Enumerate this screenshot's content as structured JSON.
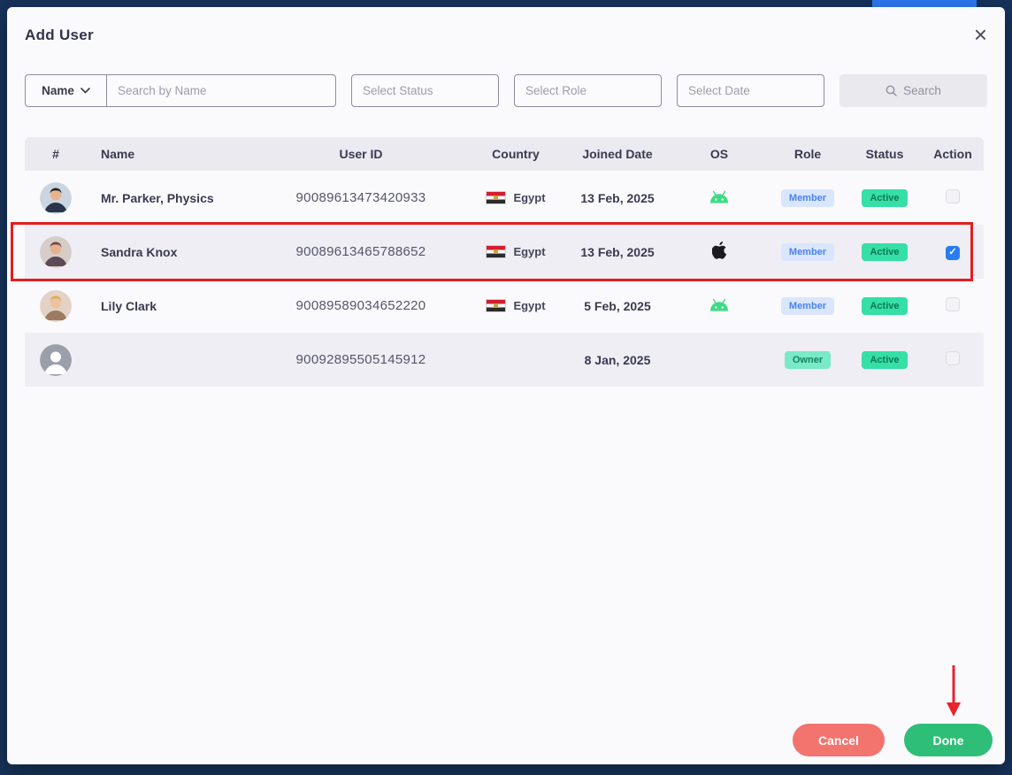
{
  "modal": {
    "title": "Add User"
  },
  "icons": {
    "close": "×",
    "check": "✓"
  },
  "filters": {
    "name_dropdown_label": "Name",
    "search_placeholder": "Search by Name",
    "status_placeholder": "Select Status",
    "role_placeholder": "Select Role",
    "date_placeholder": "Select Date",
    "search_button_label": "Search"
  },
  "table": {
    "headers": [
      "#",
      "Name",
      "User ID",
      "Country",
      "Joined Date",
      "OS",
      "Role",
      "Status",
      "Action"
    ],
    "rows": [
      {
        "name": "Mr. Parker, Physics",
        "user_id": "90089613473420933",
        "country": "Egypt",
        "joined": "13 Feb, 2025",
        "os": "android",
        "role": "Member",
        "status": "Active",
        "checked": false,
        "striped": false,
        "highlighted": false,
        "avatar": {
          "bg": "#c9d6e2",
          "skin": "#e9b48c",
          "body": "#28354d",
          "hair": "#262220"
        }
      },
      {
        "name": "Sandra Knox",
        "user_id": "90089613465788652",
        "country": "Egypt",
        "joined": "13 Feb, 2025",
        "os": "apple",
        "role": "Member",
        "status": "Active",
        "checked": true,
        "striped": true,
        "highlighted": true,
        "avatar": {
          "bg": "#d6cdc9",
          "skin": "#e6b191",
          "body": "#5d4a55",
          "hair": "#7a4636"
        }
      },
      {
        "name": "Lily Clark",
        "user_id": "90089589034652220",
        "country": "Egypt",
        "joined": "5 Feb, 2025",
        "os": "android",
        "role": "Member",
        "status": "Active",
        "checked": false,
        "striped": false,
        "highlighted": false,
        "avatar": {
          "bg": "#e4d2c6",
          "skin": "#ecc2a0",
          "body": "#9d7b63",
          "hair": "#ddad55"
        }
      },
      {
        "name": "",
        "user_id": "90092895505145912",
        "country": "",
        "joined": "8 Jan, 2025",
        "os": "",
        "role": "Owner",
        "status": "Active",
        "checked": false,
        "striped": true,
        "highlighted": false,
        "avatar": {
          "bg": "#99a0ac",
          "skin": "#ffffff",
          "body": "#ffffff",
          "hair": ""
        }
      }
    ]
  },
  "footer": {
    "cancel_label": "Cancel",
    "done_label": "Done"
  },
  "colors": {
    "backdrop": "#17335b",
    "accent_blue": "#2e7bf6",
    "annotation_red": "#e21d1f",
    "cancel": "#f3736e",
    "done": "#2fbe77",
    "active_badge": "#35dfa5",
    "member_badge_bg": "#d9e6fd",
    "member_badge_text": "#4b83f0",
    "checked_checkbox": "#2a7df0",
    "android_green": "#3ddc84"
  }
}
